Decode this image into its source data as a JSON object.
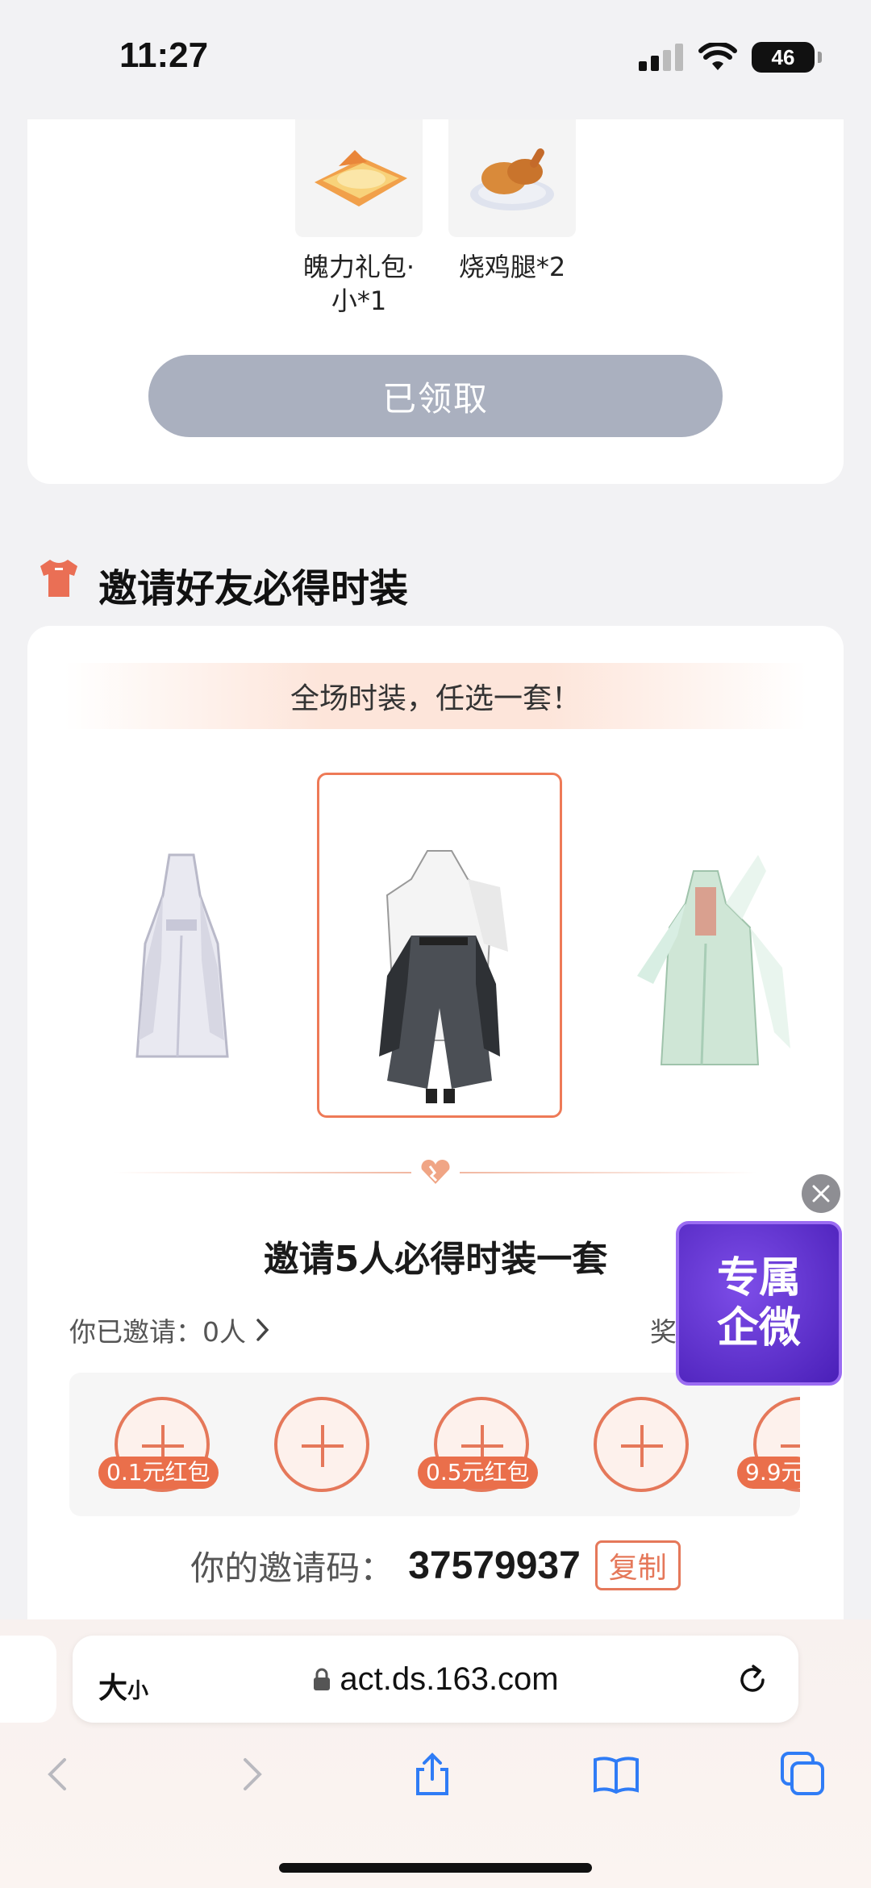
{
  "status": {
    "time": "11:27",
    "battery": "46"
  },
  "rewards": [
    {
      "name": "魄力礼包·小*1"
    },
    {
      "name": "烧鸡腿*2"
    }
  ],
  "claimed_button": "已领取",
  "section_title": "邀请好友必得时装",
  "banner": "全场时装，任选一套！",
  "invite": {
    "title": "邀请5人必得时装一套",
    "invited_label": "你已邀请：0人",
    "reward_label_partial": "奖",
    "slots": [
      {
        "badge": "0.1元红包"
      },
      {
        "badge": ""
      },
      {
        "badge": "0.5元红包"
      },
      {
        "badge": ""
      },
      {
        "badge": "9.9元"
      }
    ],
    "code_label": "你的邀请码：",
    "code_value": "37579937",
    "copy_label": "复制"
  },
  "float_widget": {
    "line1": "专属",
    "line2": "企微"
  },
  "browser": {
    "aa_big": "大",
    "aa_small": "小",
    "url": "act.ds.163.com"
  },
  "colors": {
    "accent": "#e5785a",
    "claimed": "#aab0bf",
    "widget": "#5a2cc8"
  }
}
